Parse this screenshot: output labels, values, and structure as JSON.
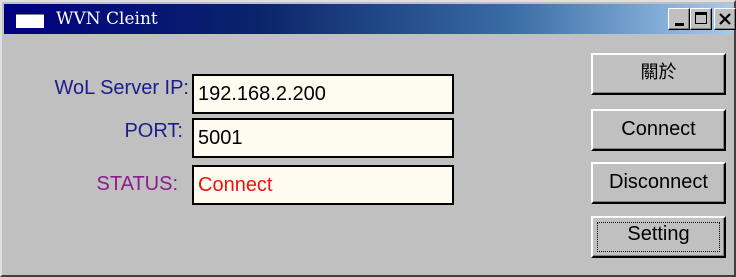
{
  "window": {
    "title": "WVN Cleint"
  },
  "form": {
    "server_ip_label": "WoL Server IP:",
    "server_ip_value": "192.168.2.200",
    "port_label": "PORT:",
    "port_value": "5001",
    "status_label": "STATUS:",
    "status_value": "Connect"
  },
  "buttons": {
    "about": "關於",
    "connect": "Connect",
    "disconnect": "Disconnect",
    "setting": "Setting"
  },
  "colors": {
    "titlebar_start": "#000080",
    "titlebar_end": "#a6caf0",
    "window_face": "#c0c0c0",
    "field_background": "#fefcf0",
    "label_blue": "#1c1c8c",
    "label_purple": "#8a1c8c",
    "status_red": "#ee1111"
  },
  "icons": {
    "app": "window-icon",
    "minimize": "minimize-icon",
    "maximize": "maximize-icon",
    "close": "close-icon"
  },
  "state": {
    "focused_button": "Setting"
  }
}
